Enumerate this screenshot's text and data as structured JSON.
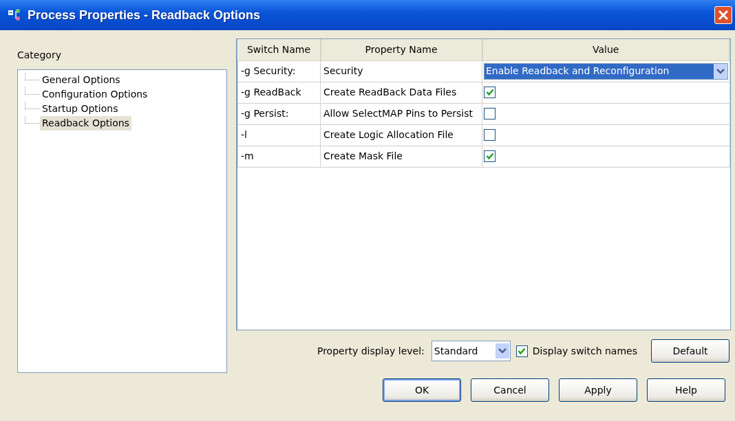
{
  "window": {
    "title": "Process Properties - Readback Options"
  },
  "category": {
    "label": "Category",
    "items": [
      {
        "label": "General Options",
        "selected": false
      },
      {
        "label": "Configuration Options",
        "selected": false
      },
      {
        "label": "Startup Options",
        "selected": false
      },
      {
        "label": "Readback Options",
        "selected": true
      }
    ]
  },
  "table": {
    "columns": [
      "Switch Name",
      "Property Name",
      "Value"
    ],
    "rows": [
      {
        "switch": "-g Security:",
        "property": "Security",
        "kind": "dropdown",
        "value": "Enable Readback and Reconfiguration"
      },
      {
        "switch": "-g ReadBack",
        "property": "Create ReadBack Data Files",
        "kind": "checkbox",
        "checked": true
      },
      {
        "switch": "-g Persist:",
        "property": "Allow SelectMAP Pins to Persist",
        "kind": "checkbox",
        "checked": false
      },
      {
        "switch": "-l",
        "property": "Create Logic Allocation File",
        "kind": "checkbox",
        "checked": false
      },
      {
        "switch": "-m",
        "property": "Create Mask File",
        "kind": "checkbox",
        "checked": true
      }
    ]
  },
  "display_level": {
    "label": "Property display level:",
    "value": "Standard"
  },
  "display_switch_names": {
    "label": "Display switch names",
    "checked": true
  },
  "default_button": "Default",
  "buttons": [
    {
      "label": "OK",
      "default": true
    },
    {
      "label": "Cancel",
      "default": false
    },
    {
      "label": "Apply",
      "default": false
    },
    {
      "label": "Help",
      "default": false
    }
  ]
}
